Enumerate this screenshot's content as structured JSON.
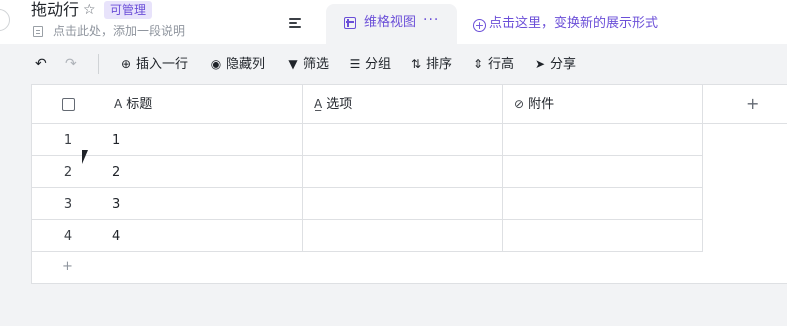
{
  "header": {
    "title": "拖动行",
    "badge": "可管理",
    "description": "点击此处，添加一段说明",
    "active_view": "维格视图",
    "more_label": "···",
    "add_view_label": "点击这里，变换新的展示形式"
  },
  "toolbar": {
    "insert_row": "插入一行",
    "hide_columns": "隐藏列",
    "filter": "筛选",
    "group": "分组",
    "sort": "排序",
    "row_height": "行高",
    "share": "分享"
  },
  "table": {
    "columns": [
      {
        "label": "标题",
        "icon": "text-icon"
      },
      {
        "label": "选项",
        "icon": "option-icon"
      },
      {
        "label": "附件",
        "icon": "attachment-icon"
      }
    ],
    "add_column": "+",
    "rows": [
      {
        "num": "1",
        "title": "1"
      },
      {
        "num": "2",
        "title": "2"
      },
      {
        "num": "3",
        "title": "3"
      },
      {
        "num": "4",
        "title": "4"
      }
    ],
    "add_row": "+"
  },
  "colors": {
    "accent": "#6b4fd8",
    "background": "#f2f3f5",
    "border": "#dee0e3"
  }
}
